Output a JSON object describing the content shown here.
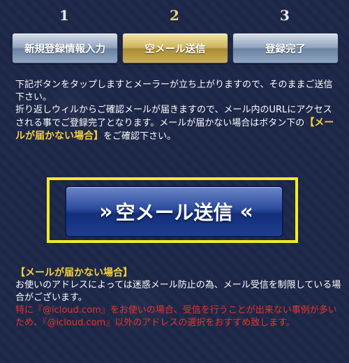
{
  "steps": [
    {
      "number": "1",
      "label": "新規登録情報入力"
    },
    {
      "number": "2",
      "label": "空メール送信"
    },
    {
      "number": "3",
      "label": "登録完了"
    }
  ],
  "instructions": {
    "line1": "下記ボタンをタップしますとメーラーが立ち上がりますので、そのままご送信下さい。",
    "line2_before": "折り返しウィルからご確認メールが届きますので、メール内のURLにアクセスされる事でご登録完了となります。メールが届かない場合はボタン下の",
    "line2_highlight": "【メールが届かない場合】",
    "line2_after": "をご確認下さい。"
  },
  "send_button": {
    "label": "空メール送信",
    "left_chevron": "»",
    "right_chevron": "«"
  },
  "notice": {
    "title": "【メールが届かない場合】",
    "body": "お使いのアドレスによっては迷惑メール防止の為、メール受信を制限している場合がございます。",
    "warning": "特に『@icloud.com』をお使いの場合、受信を行うことが出来ない事例が多いため、『@icloud.com』以外のアドレスの選択をおすすめ致します。"
  },
  "colors": {
    "background": "#1d2748",
    "highlight_yellow": "#f3d23c",
    "frame_yellow": "#f4ec22",
    "warning_red": "#e8352a"
  }
}
